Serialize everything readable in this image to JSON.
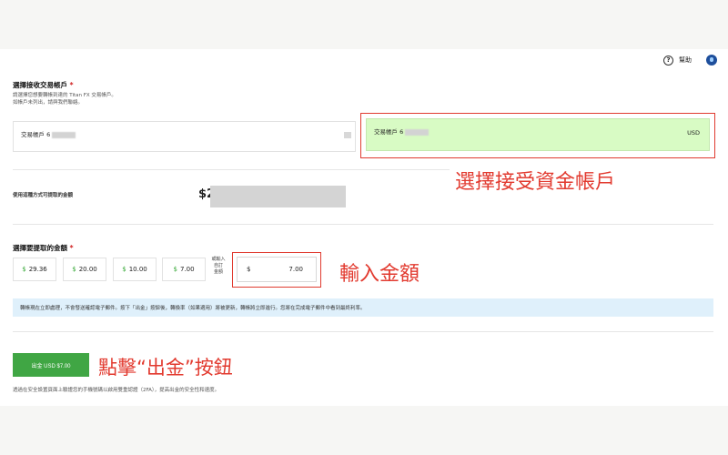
{
  "header": {
    "help_label": "幫助"
  },
  "select_account": {
    "title": "選擇接收交易帳戶",
    "required_mark": "*",
    "desc_line1": "請選擇您想要轉帳到達的 Titan FX 交易帳戶。",
    "desc_line2": "如帳戶未列出，請與我們聯絡。",
    "accounts": [
      {
        "label": "交易帳戶 6",
        "currency": "",
        "selected": false
      },
      {
        "label": "交易帳戶 6",
        "currency": "USD",
        "selected": true
      }
    ]
  },
  "available": {
    "label": "使用這種方式可提取的金額",
    "amount": "$2"
  },
  "amount_section": {
    "title": "選擇要提取的金額",
    "required_mark": "*",
    "presets": [
      {
        "currency": "$",
        "value": "29.36"
      },
      {
        "currency": "$",
        "value": "20.00"
      },
      {
        "currency": "$",
        "value": "10.00"
      },
      {
        "currency": "$",
        "value": "7.00"
      }
    ],
    "or_text_line1": "或輸入",
    "or_text_line2": "自訂",
    "or_text_line3": "金額",
    "input_currency": "$",
    "input_value": "7.00"
  },
  "notice": "轉帳現在立即處理，不會發送確認電子郵件。按下「出金」按鈕後，轉換率（如果適用）將被更新，轉帳將立即進行。您將在完成電子郵件中看到最終利率。",
  "submit": {
    "label": "出金 USD $7.00"
  },
  "footer_note": "透過在安全設置頁面上驗證您的手機號碼以啟用雙重認證（2FA），提高出金的安全性和速度。",
  "annotations": {
    "select_account": "選擇接受資金帳戶",
    "enter_amount": "輸入金額",
    "click_button": "點擊“出金”按鈕"
  },
  "colors": {
    "accent_green": "#40a644",
    "selected_bg": "#d8fbc4",
    "annotation_red": "#e23a2f",
    "notice_bg": "#dff0fb"
  }
}
